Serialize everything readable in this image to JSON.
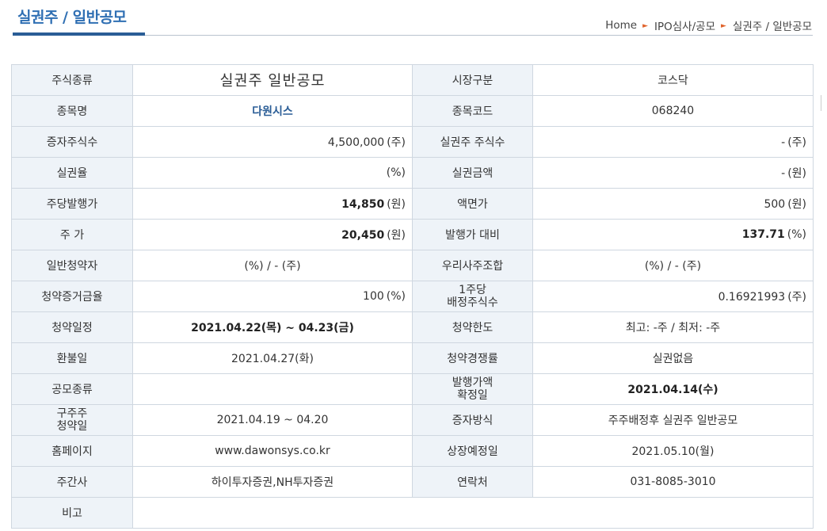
{
  "header": {
    "title": "실권주 / 일반공모",
    "breadcrumb": [
      "Home",
      "IPO심사/공모",
      "실권주 / 일반공모"
    ]
  },
  "rows": [
    {
      "l1": "주식종류",
      "v1": "실권주 일반공모",
      "l2": "시장구분",
      "v2": "코스닥"
    },
    {
      "l1": "종목명",
      "v1": "다원시스",
      "l2": "종목코드",
      "v2": "068240"
    },
    {
      "l1": "증자주식수",
      "v1": "4,500,000",
      "u1": "(주)",
      "l2": "실권주 주식수",
      "v2": "-",
      "u2": "(주)"
    },
    {
      "l1": "실권율",
      "v1": "",
      "u1": "(%)",
      "l2": "실권금액",
      "v2": "-",
      "u2": "(원)"
    },
    {
      "l1": "주당발행가",
      "v1": "14,850",
      "u1": "(원)",
      "l2": "액면가",
      "v2": "500",
      "u2": "(원)"
    },
    {
      "l1": "주 가",
      "v1": "20,450",
      "u1": "(원)",
      "l2": "발행가 대비",
      "v2": "137.71",
      "u2": "(%)"
    },
    {
      "l1": "일반청약자",
      "v1": "(%) / - (주)",
      "l2": "우리사주조합",
      "v2": "(%) / - (주)"
    },
    {
      "l1": "청약증거금율",
      "v1": "100",
      "u1": "(%)",
      "l2a": "1주당",
      "l2b": "배정주식수",
      "v2": "0.16921993",
      "u2": "(주)"
    },
    {
      "l1": "청약일정",
      "v1": "2021.04.22(목) ~ 04.23(금)",
      "l2": "청약한도",
      "v2": "최고: -주 / 최저: -주"
    },
    {
      "l1": "환불일",
      "v1": "2021.04.27(화)",
      "l2": "청약경쟁률",
      "v2": "실권없음"
    },
    {
      "l1": "공모종류",
      "v1": "",
      "l2a": "발행가액",
      "l2b": "확정일",
      "v2": "2021.04.14(수)"
    },
    {
      "l1a": "구주주",
      "l1b": "청약일",
      "v1": "2021.04.19 ~ 04.20",
      "l2": "증자방식",
      "v2": "주주배정후 실권주 일반공모"
    },
    {
      "l1": "홈페이지",
      "v1": "www.dawonsys.co.kr",
      "l2": "상장예정일",
      "v2": "2021.05.10(월)"
    },
    {
      "l1": "주간사",
      "v1": "하이투자증권,NH투자증권",
      "l2": "연락처",
      "v2": "031-8085-3010"
    },
    {
      "l1": "비고",
      "v1": ""
    }
  ],
  "colors": {
    "title": "#2f6fb3",
    "label_bg": "#eef3f8",
    "border": "#cfd7e0",
    "link": "#2a5d96",
    "crumb_sep": "#e0622a"
  }
}
